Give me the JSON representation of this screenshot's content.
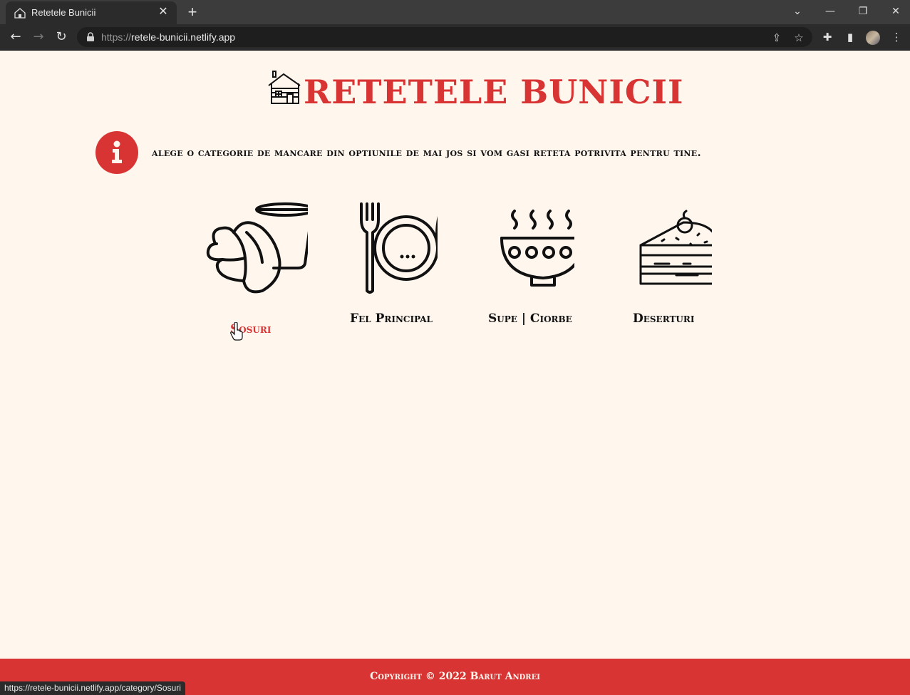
{
  "browser": {
    "tab_title": "Retetele Bunicii",
    "tab_close": "✕",
    "new_tab": "+",
    "url_scheme": "https://",
    "url_host": "retele-bunicii.netlify.app",
    "status_url": "https://retele-bunicii.netlify.app/category/Sosuri"
  },
  "page": {
    "title": "RETETELE BUNICII",
    "info": "alege o categorie de mancare din optiunile de mai jos si vom gasi reteta potrivita pentru tine.",
    "categories": [
      {
        "label": "Sosuri",
        "icon": "croissant-cup-icon",
        "active": true
      },
      {
        "label": "Fel Principal",
        "icon": "plate-fork-knife-icon",
        "active": false
      },
      {
        "label": "Supe | Ciorbe",
        "icon": "soup-bowl-icon",
        "active": false
      },
      {
        "label": "Deserturi",
        "icon": "cake-slice-icon",
        "active": false
      }
    ],
    "footer": "Copyright © 2022 Barut Andrei"
  },
  "colors": {
    "accent": "#d83434",
    "background": "#fff6ee",
    "text": "#111111"
  }
}
